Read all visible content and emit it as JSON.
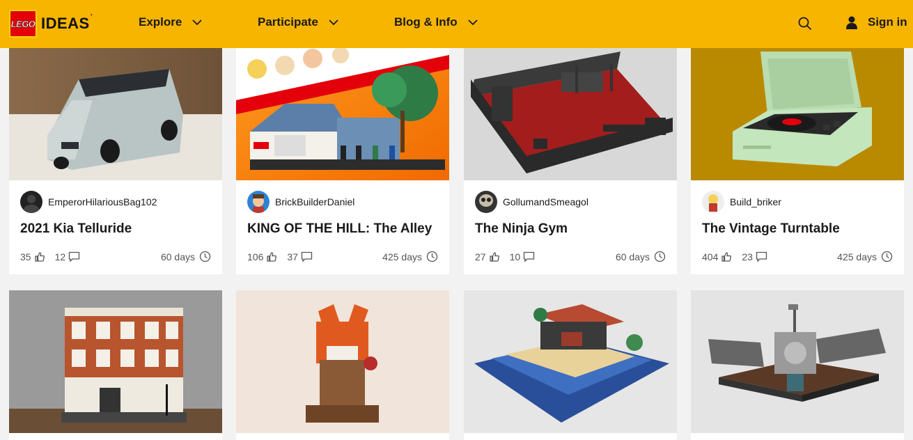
{
  "brand": {
    "badge": "LEGO",
    "name": "IDEAS"
  },
  "nav": {
    "explore": "Explore",
    "participate": "Participate",
    "blog": "Blog & Info",
    "signin": "Sign in"
  },
  "colors": {
    "header": "#f7b500",
    "lego_red": "#e3000b"
  },
  "cards": [
    {
      "author": "EmperorHilariousBag102",
      "title": "2021 Kia Telluride",
      "likes": "35",
      "comments": "12",
      "days": "60 days"
    },
    {
      "author": "BrickBuilderDaniel",
      "title": "KING OF THE HILL: The Alley",
      "likes": "106",
      "comments": "37",
      "days": "425 days"
    },
    {
      "author": "GollumandSmeagol",
      "title": "The Ninja Gym",
      "likes": "27",
      "comments": "10",
      "days": "60 days"
    },
    {
      "author": "Build_briker",
      "title": "The Vintage Turntable",
      "likes": "404",
      "comments": "23",
      "days": "425 days"
    }
  ]
}
